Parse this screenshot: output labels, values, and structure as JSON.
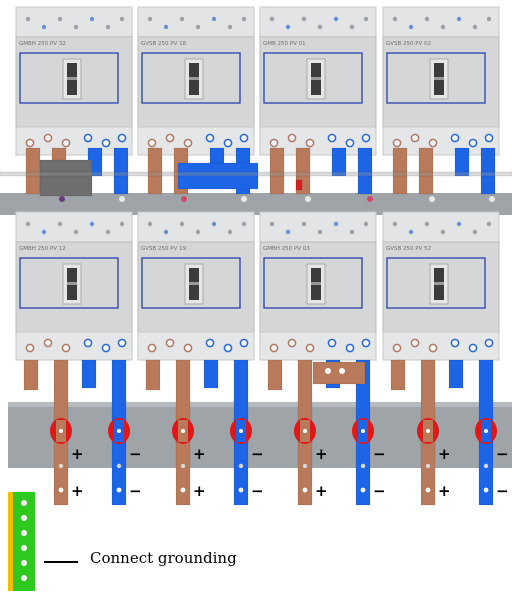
{
  "breakers": {
    "top": [
      "GMBH 250 PV 32",
      "GVSB 250 PV 18",
      "GMB 250 PV 01",
      "GVSB 250 PV 02"
    ],
    "bottom": [
      "GMBH 250 PV 12",
      "GVSB 250 PV 19",
      "GMBH 250 PV 03",
      "GVSB 250 PV 52"
    ]
  },
  "polarity": {
    "positive": "+",
    "negative": "−"
  },
  "legend": {
    "grounding_label": "Connect grounding"
  },
  "colors": {
    "copper_bar": "#b87a5a",
    "blue_bar": "#1e64e6",
    "red_clamp": "#e01818",
    "busbar_gray": "#9ea4a8",
    "breaker_body": "#d4d6d8",
    "ground_green": "#2ec81e",
    "ground_yellow": "#f0c000"
  }
}
